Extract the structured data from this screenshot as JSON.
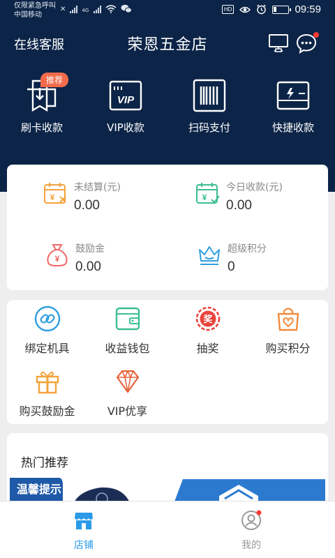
{
  "status_bar": {
    "carrier_line1": "仅限紧急呼叫",
    "carrier_line2": "中国移动",
    "network_label": "4G",
    "hd_label": "HD",
    "time": "09:59",
    "battery_level": 0.2
  },
  "header": {
    "online_service": "在线客服",
    "title": "荣恩五金店",
    "bg_color": "#0c2447"
  },
  "quick_actions": [
    {
      "label": "刷卡收款",
      "tag": "推荐"
    },
    {
      "label": "VIP收款",
      "icon_text": "VIP"
    },
    {
      "label": "扫码支付"
    },
    {
      "label": "快捷收款"
    }
  ],
  "stats": [
    {
      "title": "未结算(元)",
      "value": "0.00"
    },
    {
      "title": "今日收款(元)",
      "value": "0.00"
    },
    {
      "title": "鼓励金",
      "value": "0.00"
    },
    {
      "title": "超级积分",
      "value": "0"
    }
  ],
  "services": [
    {
      "label": "绑定机具"
    },
    {
      "label": "收益钱包"
    },
    {
      "label": "抽奖",
      "icon_text": "奖"
    },
    {
      "label": "购买积分"
    },
    {
      "label": "购买鼓励金"
    },
    {
      "label": "VIP优享"
    }
  ],
  "hot": {
    "title": "热门推荐",
    "banner_text": "温馨提示"
  },
  "bottom_nav": [
    {
      "label": "店铺",
      "active": true
    },
    {
      "label": "我的",
      "active": false
    }
  ],
  "colors": {
    "primary": "#0c2447",
    "active_nav": "#2b9be8",
    "inactive_nav": "#999999",
    "badge_red": "#ff3b30",
    "tag_orange": "#f36b4b"
  }
}
